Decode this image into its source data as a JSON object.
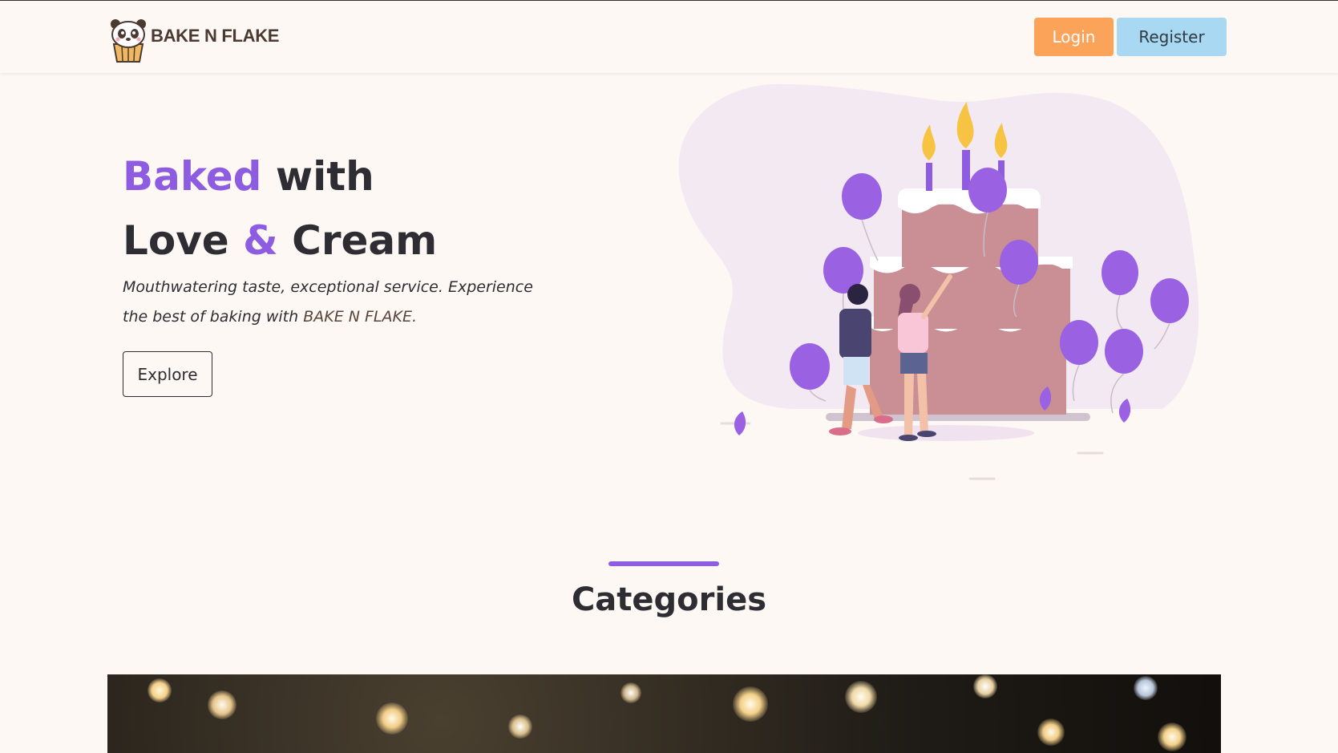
{
  "header": {
    "brand_name": "BAKE N FLAKE",
    "login_label": "Login",
    "register_label": "Register"
  },
  "hero": {
    "title_word1": "Baked",
    "title_word2": "with",
    "title_word3": "Love",
    "title_amp": "&",
    "title_word4": "Cream",
    "subtitle_text": "Mouthwatering taste, exceptional service. Experience the best of baking with ",
    "subtitle_brand": "BAKE N FLAKE.",
    "explore_label": "Explore"
  },
  "categories": {
    "title": "Categories"
  },
  "colors": {
    "accent": "#8e5ce0",
    "login_bg": "#fca35a",
    "register_bg": "#a9d9f2",
    "page_bg": "#fdf8f3"
  },
  "icons": [
    "panda-cupcake-logo-icon",
    "birthday-cake-illustration"
  ]
}
